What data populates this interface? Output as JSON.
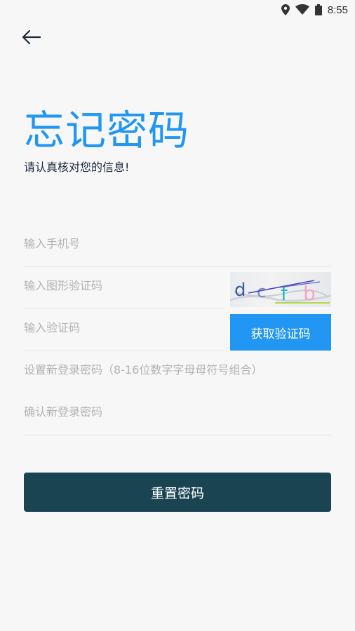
{
  "status": {
    "time": "8:55",
    "icons": [
      "location-icon",
      "wifi-icon",
      "battery-icon"
    ]
  },
  "header": {
    "back_icon": "back-arrow-icon"
  },
  "title": "忘记密码",
  "subtitle": "请认真核对您的信息!",
  "form": {
    "phone_placeholder": "输入手机号",
    "captcha_placeholder": "输入图形验证码",
    "captcha_image_text": "dcfb",
    "sms_code_placeholder": "输入验证码",
    "get_code_label": "获取验证码",
    "new_password_placeholder": "设置新登录密码（8-16位数字字母母符号组合）",
    "confirm_password_placeholder": "确认新登录密码"
  },
  "reset_button_label": "重置密码",
  "colors": {
    "accent": "#2196f3",
    "primary_button": "#1b4453",
    "background": "#f7f7f8"
  }
}
